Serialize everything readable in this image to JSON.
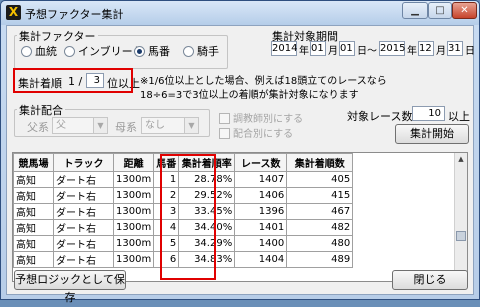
{
  "window": {
    "title": "予想ファクター集計",
    "icon_letter": "X"
  },
  "factor": {
    "label": "集計ファクター",
    "options": [
      {
        "label": "血統",
        "selected": false
      },
      {
        "label": "インブリード",
        "selected": false
      },
      {
        "label": "馬番",
        "selected": true
      },
      {
        "label": "騎手",
        "selected": false
      }
    ]
  },
  "period": {
    "label": "集計対象期間",
    "start": {
      "year": "2014",
      "month": "01",
      "day": "01"
    },
    "end": {
      "year": "2015",
      "month": "12",
      "day": "31"
    },
    "year_unit": "年",
    "month_unit": "月",
    "day_unit": "日",
    "range_sep": "～"
  },
  "order": {
    "label": "集計着順",
    "prefix": "1 /",
    "value": "3",
    "suffix": "位以上",
    "note_line1": "※1/6位以上とした場合、例えば18頭立てのレースなら",
    "note_line2": "18÷6=3で3位以上の着順が集計対象になります"
  },
  "blend": {
    "label": "集計配合",
    "father_label": "父系",
    "father_value": "父",
    "mother_label": "母系",
    "mother_value": "なし",
    "check1": "調教師別にする",
    "check2": "配合別にする"
  },
  "races": {
    "label": "対象レース数",
    "value": "10",
    "suffix": "以上"
  },
  "buttons": {
    "start": "集計開始",
    "save": "予想ロジックとして保存",
    "close": "閉じる"
  },
  "table": {
    "headers": [
      "競馬場",
      "トラック",
      "距離",
      "馬番",
      "集計着順率",
      "レース数",
      "集計着順数"
    ],
    "rows": [
      [
        "高知",
        "ダート右",
        "1300m",
        "1",
        "28.78%",
        "1407",
        "405"
      ],
      [
        "高知",
        "ダート右",
        "1300m",
        "2",
        "29.52%",
        "1406",
        "415"
      ],
      [
        "高知",
        "ダート右",
        "1300m",
        "3",
        "33.45%",
        "1396",
        "467"
      ],
      [
        "高知",
        "ダート右",
        "1300m",
        "4",
        "34.40%",
        "1401",
        "482"
      ],
      [
        "高知",
        "ダート右",
        "1300m",
        "5",
        "34.29%",
        "1400",
        "480"
      ],
      [
        "高知",
        "ダート右",
        "1300m",
        "6",
        "34.83%",
        "1404",
        "489"
      ]
    ]
  }
}
